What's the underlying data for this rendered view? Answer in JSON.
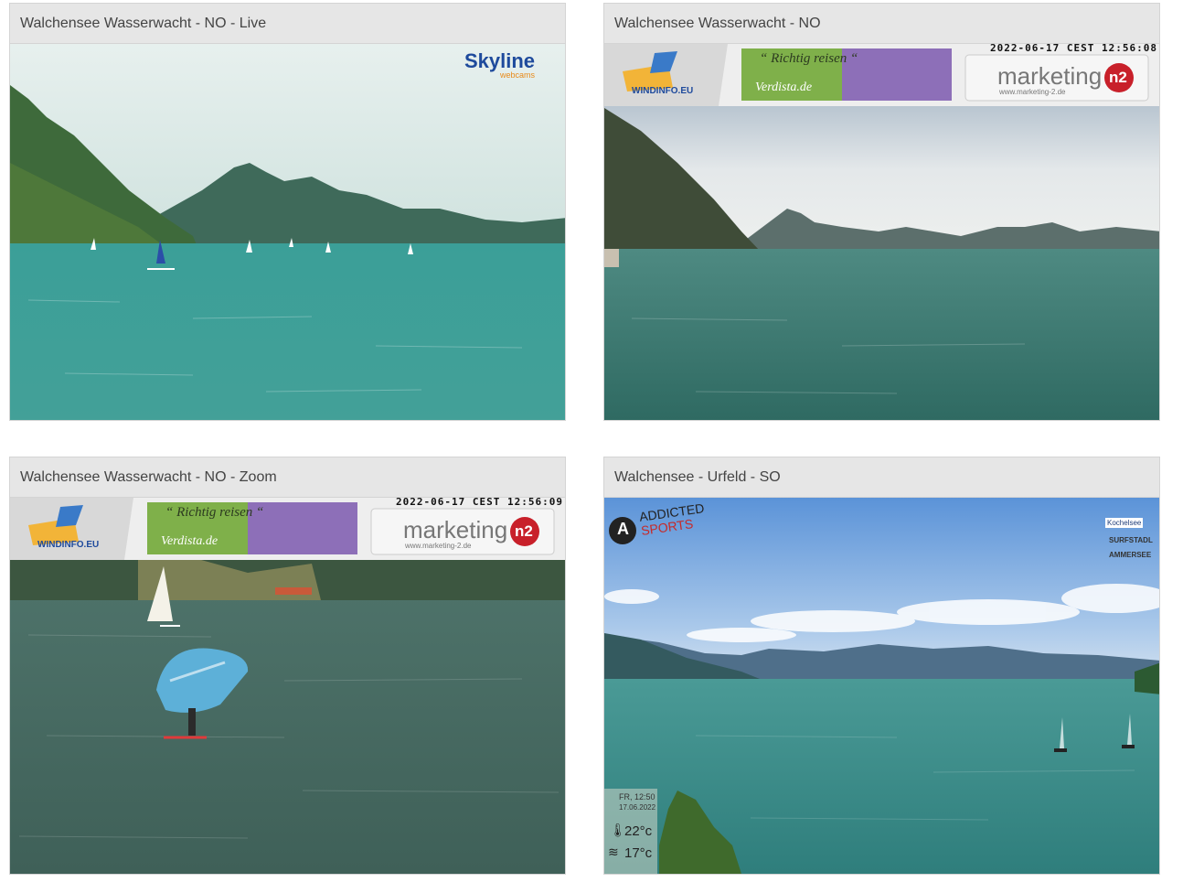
{
  "cams": [
    {
      "title": "Walchensee Wasserwacht - NO - Live",
      "overlay": {
        "brand": "Skyline",
        "sub": "webcams",
        "brand_color": "#1e4a9c",
        "sub_color": "#e88a1a"
      }
    },
    {
      "title": "Walchensee Wasserwacht - NO",
      "overlay": {
        "timestamp": "2022-06-17 CEST 12:56:08",
        "windinfo": "WINDINFO.EU",
        "ad_line1": "“ Richtig reisen “",
        "ad_line2": "Verdista.de",
        "marketing": "marketing",
        "marketing_badge": "n2",
        "marketing_url": "www.marketing-2.de"
      }
    },
    {
      "title": "Walchensee Wasserwacht - NO - Zoom",
      "overlay": {
        "timestamp": "2022-06-17 CEST 12:56:09",
        "windinfo": "WINDINFO.EU",
        "ad_line1": "“ Richtig reisen “",
        "ad_line2": "Verdista.de",
        "marketing": "marketing",
        "marketing_badge": "n2",
        "marketing_url": "www.marketing-2.de"
      }
    },
    {
      "title": "Walchensee - Urfeld - SO",
      "overlay": {
        "brand_line1": "ADDICTED",
        "brand_line2": "SPORTS",
        "brand_letter": "A",
        "right_logo_line1": "Kochelsee",
        "right_logo_line2": "SURFSTADL",
        "right_logo_line3": "AMMERSEE",
        "day_time": "FR, 12:50",
        "date": "17.06.2022",
        "air_temp": "22°c",
        "water_temp": "17°c"
      }
    }
  ],
  "colors": {
    "header_bg": "#e6e6e6",
    "header_text": "#444444",
    "border": "#d4d4d4",
    "lake": "#3f9a95",
    "lake_dark": "#3f7070",
    "sky": "#d8e8e8"
  }
}
